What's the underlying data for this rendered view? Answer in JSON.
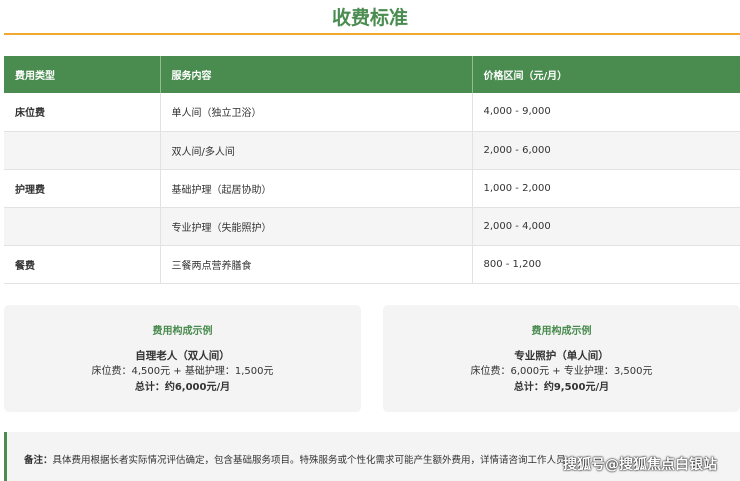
{
  "title": "收费标准",
  "table": {
    "headers": [
      "费用类型",
      "服务内容",
      "价格区间（元/月）"
    ],
    "rows": [
      {
        "type": "床位费",
        "service": "单人间（独立卫浴）",
        "price": "4,000 - 9,000"
      },
      {
        "type": "",
        "service": "双人间/多人间",
        "price": "2,000 - 6,000"
      },
      {
        "type": "护理费",
        "service": "基础护理（起居协助）",
        "price": "1,000 - 2,000"
      },
      {
        "type": "",
        "service": "专业护理（失能照护）",
        "price": "2,000 - 4,000"
      },
      {
        "type": "餐费",
        "service": "三餐两点营养膳食",
        "price": "800 - 1,200"
      }
    ]
  },
  "examples": [
    {
      "heading": "费用构成示例",
      "name": "自理老人（双人间）",
      "detail": "床位费：4,500元 + 基础护理：1,500元",
      "total": "总计：约6,000元/月"
    },
    {
      "heading": "费用构成示例",
      "name": "专业照护（单人间）",
      "detail": "床位费：6,000元 + 专业护理：3,500元",
      "total": "总计：约9,500元/月"
    }
  ],
  "note": {
    "label": "备注：",
    "text": "具体费用根据长者实际情况评估确定，包含基础服务项目。特殊服务或个性化需求可能产生额外费用，详情请咨询工作人员。"
  },
  "watermark": "搜狐号@搜狐焦点白银站"
}
